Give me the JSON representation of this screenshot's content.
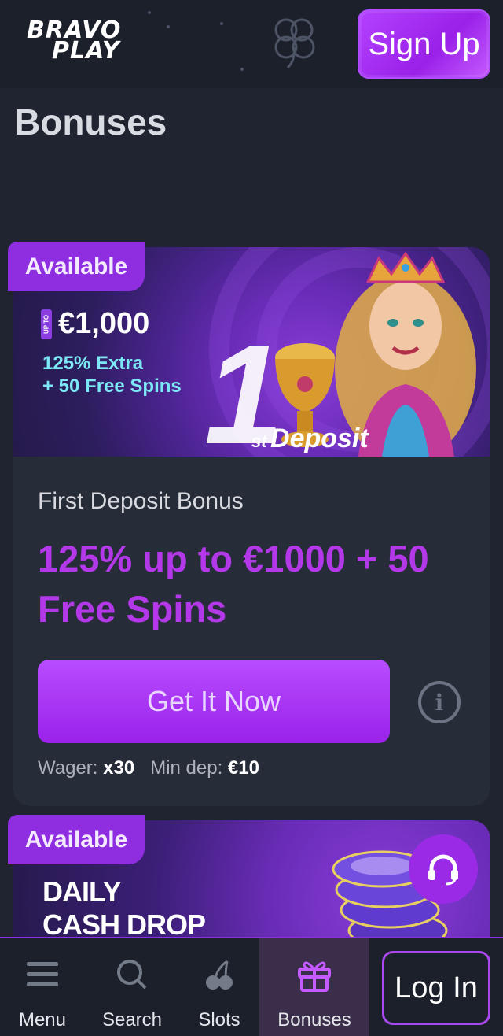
{
  "header": {
    "logo_line1": "BRAVO",
    "logo_line2": "PLAY",
    "signup_label": "Sign Up"
  },
  "page_title": "Bonuses",
  "bonus_card": {
    "tag": "Available",
    "banner": {
      "upto_badge": "UP TO",
      "amount": "€1,000",
      "line1": "125% Extra",
      "line2": "+ 50 Free Spins",
      "big_number": "1",
      "suffix": "st",
      "deposit_word": "Deposit"
    },
    "name": "First Deposit Bonus",
    "offer": "125% up to €1000 + 50 Free Spins",
    "cta_label": "Get It Now",
    "info_icon": "info-icon",
    "wager_label": "Wager:",
    "wager_value": "x30",
    "min_dep_label": "Min dep:",
    "min_dep_value": "€10"
  },
  "second_card": {
    "tag": "Available",
    "title_line1": "DAILY",
    "title_line2": "CASH DROP"
  },
  "support_icon": "headset-icon",
  "bottom_nav": {
    "items": [
      {
        "label": "Menu",
        "icon": "menu-icon"
      },
      {
        "label": "Search",
        "icon": "search-icon"
      },
      {
        "label": "Slots",
        "icon": "cherry-icon"
      },
      {
        "label": "Bonuses",
        "icon": "gift-icon",
        "active": true
      }
    ],
    "login_label": "Log In"
  },
  "colors": {
    "background": "#1f2430",
    "accent": "#9a22ea",
    "offer_text": "#b338e8",
    "banner_cyan": "#7de8f5"
  }
}
